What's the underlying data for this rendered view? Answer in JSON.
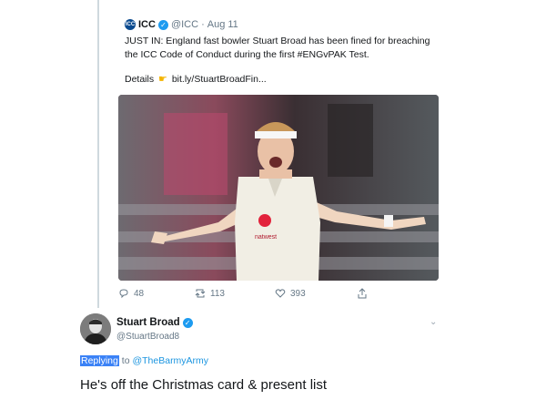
{
  "quoted_tweet": {
    "author_name": "ICC",
    "author_handle": "@ICC",
    "separator": "·",
    "date": "Aug 11",
    "text": "JUST IN: England fast bowler Stuart Broad has been fined for breaching the ICC Code of Conduct during the first #ENGvPAK Test.",
    "details_label": "Details",
    "link": "bit.ly/StuartBroadFin...",
    "logo_text": "ICC",
    "shirt_text": "natwest",
    "stats": {
      "replies": "48",
      "retweets": "113",
      "likes": "393"
    }
  },
  "reply_tweet": {
    "author_name": "Stuart Broad",
    "author_handle": "@StuartBroad8",
    "replying_label": "Replying",
    "replying_to": "to",
    "replying_handle": "@TheBarmyArmy",
    "text": "He's off the Christmas card & present list"
  },
  "colors": {
    "link_blue": "#1b95e0",
    "verified_blue": "#1d9bf0",
    "muted": "#657786",
    "highlight": "#3b82f6"
  },
  "icons": [
    "verified-badge",
    "pointing-hand",
    "reply-icon",
    "retweet-icon",
    "like-icon",
    "share-icon",
    "more-icon"
  ]
}
